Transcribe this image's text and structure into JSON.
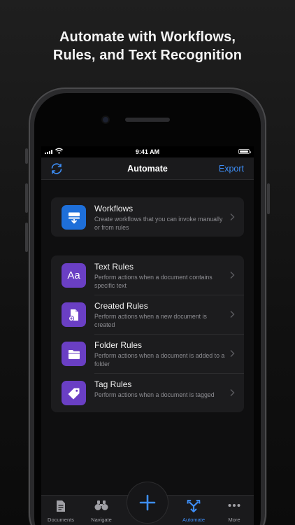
{
  "headline": {
    "line1": "Automate with Workflows,",
    "line2": "Rules, and Text Recognition"
  },
  "status_bar": {
    "time": "9:41 AM"
  },
  "nav": {
    "title": "Automate",
    "export_label": "Export",
    "sync_icon": "sync-icon"
  },
  "workflows": {
    "title": "Workflows",
    "subtitle": "Create workflows that you can invoke manually or from rules",
    "icon": "workflow-icon",
    "color": "#1e6fd9"
  },
  "rules": [
    {
      "title": "Text Rules",
      "subtitle": "Perform actions when a document contains specific text",
      "icon": "text-rules-icon",
      "glyph": "Aa"
    },
    {
      "title": "Created Rules",
      "subtitle": "Perform actions when a new document is created",
      "icon": "new-document-icon"
    },
    {
      "title": "Folder Rules",
      "subtitle": "Perform actions when a document is added to a folder",
      "icon": "folder-icon"
    },
    {
      "title": "Tag Rules",
      "subtitle": "Perform actions when a document is tagged",
      "icon": "tag-icon"
    }
  ],
  "rule_color": "#6a3fc4",
  "tabs": [
    {
      "label": "Documents",
      "icon": "documents-icon"
    },
    {
      "label": "Navigate",
      "icon": "binoculars-icon"
    },
    {
      "label": "Automate",
      "icon": "automate-icon",
      "active": true
    },
    {
      "label": "More",
      "icon": "more-icon"
    }
  ],
  "fab": {
    "icon": "plus-icon"
  },
  "accent_color": "#3d8ef7"
}
